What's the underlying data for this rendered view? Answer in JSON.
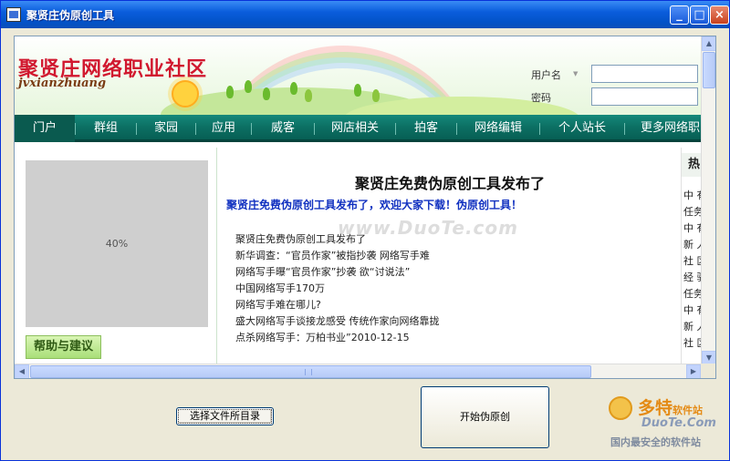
{
  "window": {
    "title": "聚贤庄伪原创工具",
    "controls": {
      "minimize": "_",
      "maximize": "□",
      "close": "×"
    }
  },
  "site": {
    "name": "聚贤庄网络职业社区",
    "pinyin": "jvxianzhuang",
    "login": {
      "username_label": "用户名",
      "password_label": "密码",
      "username_value": "",
      "password_value": ""
    }
  },
  "nav": {
    "items": [
      "门户",
      "群组",
      "家园",
      "应用",
      "威客",
      "网店相关",
      "拍客",
      "网络编辑",
      "个人站长",
      "更多网络职"
    ],
    "active": "门户"
  },
  "left": {
    "image_placeholder": "40%",
    "help_button": "帮助与建议"
  },
  "article": {
    "title": "聚贤庄免费伪原创工具发布了",
    "subtitle": "聚贤庄免费伪原创工具发布了，欢迎大家下载！伪原创工具！",
    "watermark": "www.DuoTe.com",
    "list": [
      "聚贤庄免费伪原创工具发布了",
      "新华调查：“官员作家”被指抄袭 网络写手难",
      "网络写手曝“官员作家”抄袭 欲“讨说法”",
      "中国网络写手170万",
      "网络写手难在哪儿?",
      "盛大网络写手谈接龙感受 传统作家向网络靠拢",
      "点杀网络写手：万柏书业”2010-12-15"
    ]
  },
  "right": {
    "header": "热",
    "items": [
      "中 有",
      "任务",
      "中 有",
      "新 人",
      "社 区",
      "经 验",
      "任务",
      "中 有",
      "新 人",
      "社 区"
    ]
  },
  "buttons": {
    "select_dir": "选择文件所目录",
    "start": "开始伪原创"
  },
  "brand": {
    "name": "多特",
    "name_suffix": "软件站",
    "url": "DuoTe.Com",
    "slogan": "国内最安全的软件站"
  },
  "colors": {
    "titlebar": "#0a5ddc",
    "nav_bg": "#0c6f63",
    "site_name": "#d1182f",
    "article_subtitle": "#1030c0"
  }
}
